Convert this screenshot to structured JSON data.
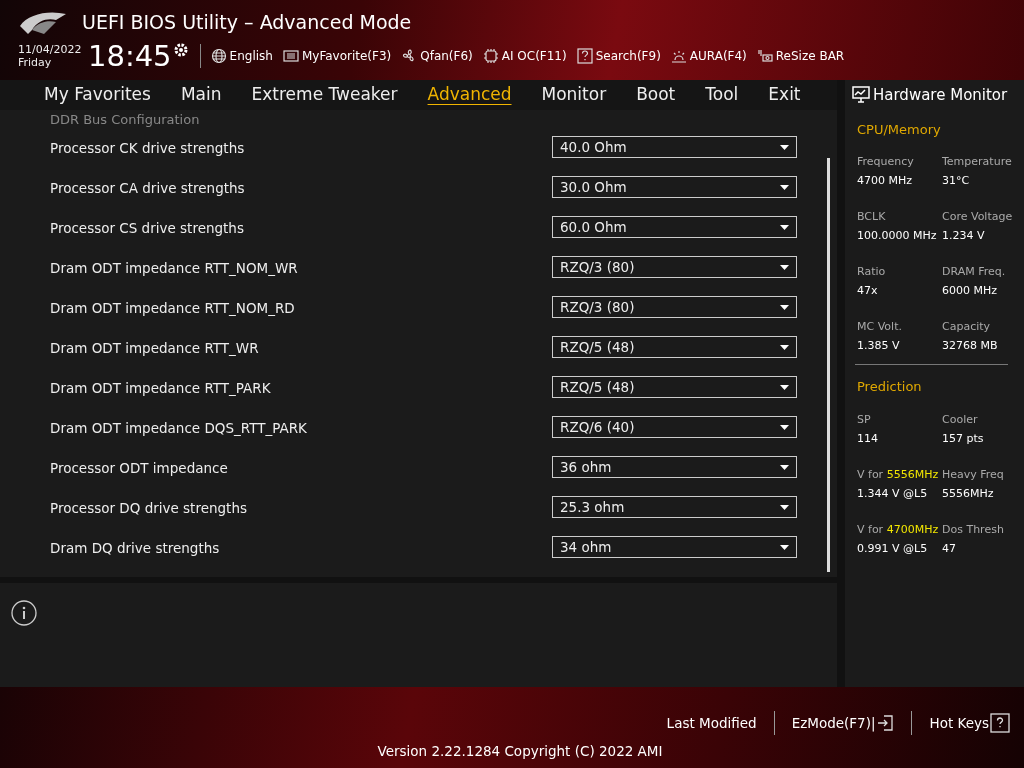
{
  "window": {
    "title": "UEFI BIOS Utility – Advanced Mode"
  },
  "clock": {
    "date": "11/04/2022",
    "day": "Friday",
    "time": "18:45"
  },
  "toolbar": [
    {
      "label": "English"
    },
    {
      "label": "MyFavorite(F3)"
    },
    {
      "label": "Qfan(F6)"
    },
    {
      "label": "AI OC(F11)"
    },
    {
      "label": "Search(F9)"
    },
    {
      "label": "AURA(F4)"
    },
    {
      "label": "ReSize BAR"
    }
  ],
  "tabs": [
    {
      "label": "My Favorites",
      "selected": false
    },
    {
      "label": "Main",
      "selected": false
    },
    {
      "label": "Extreme Tweaker",
      "selected": false
    },
    {
      "label": "Advanced",
      "selected": true
    },
    {
      "label": "Monitor",
      "selected": false
    },
    {
      "label": "Boot",
      "selected": false
    },
    {
      "label": "Tool",
      "selected": false
    },
    {
      "label": "Exit",
      "selected": false
    }
  ],
  "section_heading": "DDR Bus Configuration",
  "settings": [
    {
      "label": "Processor CK drive strengths",
      "value": "40.0 Ohm"
    },
    {
      "label": "Processor CA drive strengths",
      "value": "30.0 Ohm"
    },
    {
      "label": "Processor CS drive strengths",
      "value": "60.0 Ohm"
    },
    {
      "label": "Dram ODT impedance RTT_NOM_WR",
      "value": "RZQ/3 (80)"
    },
    {
      "label": "Dram ODT impedance RTT_NOM_RD",
      "value": "RZQ/3 (80)"
    },
    {
      "label": "Dram ODT impedance RTT_WR",
      "value": "RZQ/5 (48)"
    },
    {
      "label": "Dram ODT impedance RTT_PARK",
      "value": "RZQ/5 (48)"
    },
    {
      "label": "Dram ODT impedance DQS_RTT_PARK",
      "value": "RZQ/6 (40)"
    },
    {
      "label": "Processor ODT impedance",
      "value": "36 ohm"
    },
    {
      "label": "Processor DQ drive strengths",
      "value": "25.3 ohm"
    },
    {
      "label": "Dram DQ drive strengths",
      "value": "34 ohm"
    }
  ],
  "hardware_monitor": {
    "title": "Hardware Monitor",
    "sections": [
      {
        "title": "CPU/Memory",
        "items": [
          {
            "label": "Frequency",
            "value": "4700 MHz"
          },
          {
            "label": "Temperature",
            "value": "31°C"
          },
          {
            "label": "BCLK",
            "value": "100.0000 MHz"
          },
          {
            "label": "Core Voltage",
            "value": "1.234 V"
          },
          {
            "label": "Ratio",
            "value": "47x"
          },
          {
            "label": "DRAM Freq.",
            "value": "6000 MHz"
          },
          {
            "label": "MC Volt.",
            "value": "1.385 V"
          },
          {
            "label": "Capacity",
            "value": "32768 MB"
          }
        ]
      },
      {
        "title": "Prediction",
        "items": [
          {
            "label": "SP",
            "value": "114"
          },
          {
            "label": "Cooler",
            "value": "157 pts"
          },
          {
            "label": "V for ",
            "highlight": "5556MHz",
            "value": "1.344 V @L5"
          },
          {
            "label": "Heavy Freq",
            "value": "5556MHz"
          },
          {
            "label": "V for ",
            "highlight": "4700MHz",
            "value": "0.991 V @L5"
          },
          {
            "label": "Dos Thresh",
            "value": "47"
          }
        ]
      }
    ]
  },
  "footer": {
    "buttons": [
      {
        "label": "Last Modified"
      },
      {
        "label": "EzMode(F7)|"
      },
      {
        "label": "Hot Keys"
      }
    ],
    "version": "Version 2.22.1284 Copyright (C) 2022 AMI"
  }
}
